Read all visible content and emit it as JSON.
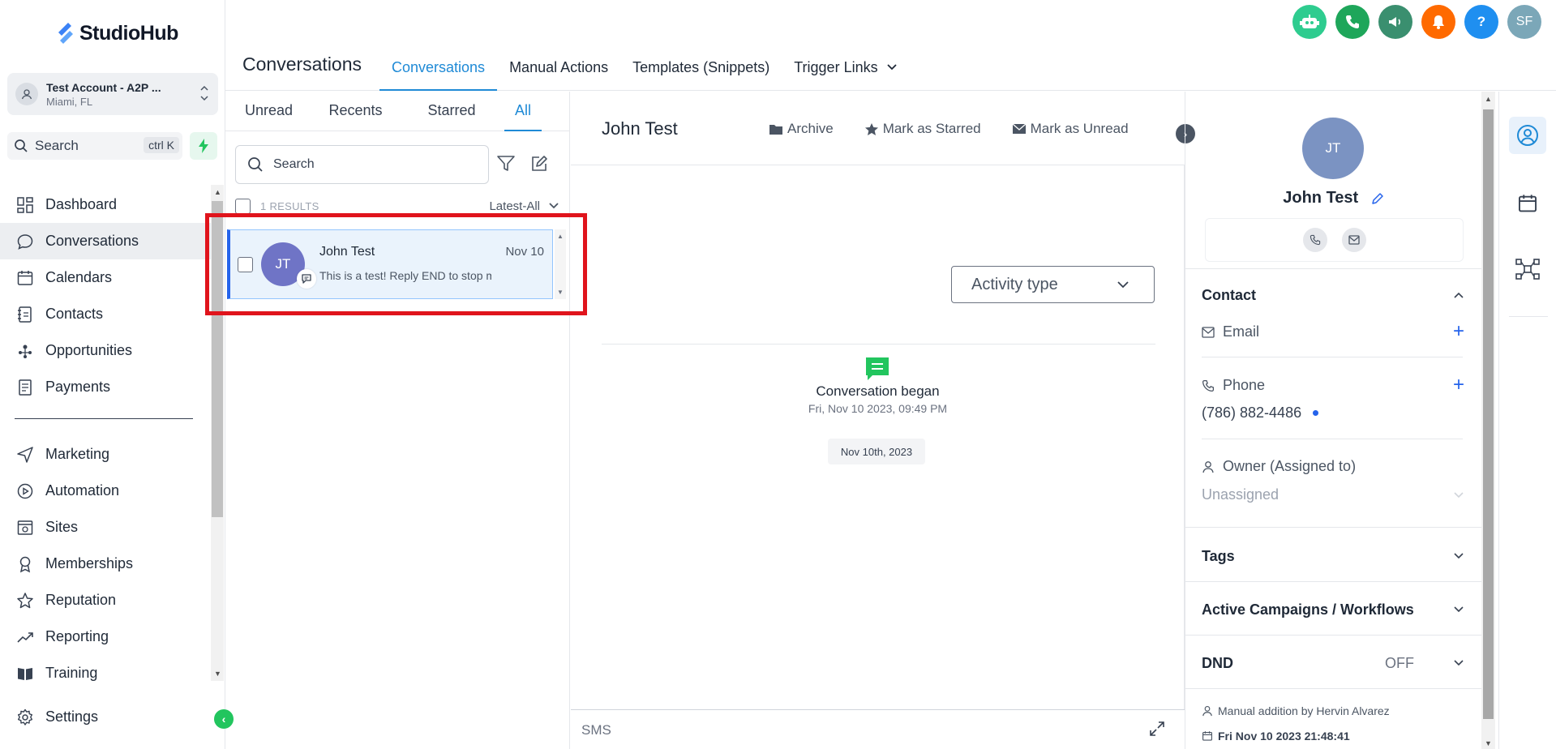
{
  "brand": {
    "name": "StudioHub"
  },
  "account": {
    "name": "Test Account - A2P ...",
    "location": "Miami, FL"
  },
  "sidebar_search": {
    "label": "Search",
    "shortcut": "ctrl K"
  },
  "nav": {
    "primary": [
      {
        "label": "Dashboard",
        "icon": "dashboard-icon"
      },
      {
        "label": "Conversations",
        "icon": "chat-bubble-icon"
      },
      {
        "label": "Calendars",
        "icon": "calendar-icon"
      },
      {
        "label": "Contacts",
        "icon": "contacts-icon"
      },
      {
        "label": "Opportunities",
        "icon": "opportunities-icon"
      },
      {
        "label": "Payments",
        "icon": "payments-icon"
      }
    ],
    "secondary": [
      {
        "label": "Marketing",
        "icon": "send-icon"
      },
      {
        "label": "Automation",
        "icon": "automation-icon"
      },
      {
        "label": "Sites",
        "icon": "sites-icon"
      },
      {
        "label": "Memberships",
        "icon": "badge-icon"
      },
      {
        "label": "Reputation",
        "icon": "star-icon"
      },
      {
        "label": "Reporting",
        "icon": "trend-icon"
      },
      {
        "label": "Training",
        "icon": "book-icon"
      }
    ],
    "settings_label": "Settings"
  },
  "header": {
    "title": "Conversations",
    "tabs": [
      "Conversations",
      "Manual Actions",
      "Templates (Snippets)",
      "Trigger Links"
    ],
    "avatar_initials": "SF",
    "help_label": "?"
  },
  "colors": {
    "accent": "#1f8ad6",
    "bot": "#2ecc8f",
    "phone": "#1ea65a",
    "megaphone": "#3a8f6f",
    "bell": "#ff6a00",
    "help": "#1f8ff0",
    "user": "#7ba7b8"
  },
  "list": {
    "tabs": [
      "Unread",
      "Recents",
      "Starred",
      "All"
    ],
    "search_placeholder": "Search",
    "results_label": "1 RESULTS",
    "sort_label": "Latest-All",
    "items": [
      {
        "initials": "JT",
        "name": "John Test",
        "date": "Nov 10",
        "snippet": "This is a test! Reply END to stop m"
      }
    ]
  },
  "chat": {
    "contact_name": "John Test",
    "actions": [
      "Archive",
      "Mark as Starred",
      "Mark as Unread"
    ],
    "activity_type_placeholder": "Activity type",
    "began_title": "Conversation began",
    "began_time": "Fri, Nov 10 2023, 09:49 PM",
    "date_pill": "Nov 10th, 2023",
    "composer_channel": "SMS"
  },
  "contact": {
    "initials": "JT",
    "name": "John Test",
    "section_contact": "Contact",
    "email_label": "Email",
    "phone_label": "Phone",
    "phone_value": "(786) 882-4486",
    "owner_label": "Owner (Assigned to)",
    "owner_value": "Unassigned",
    "tags_label": "Tags",
    "campaigns_label": "Active Campaigns / Workflows",
    "dnd_label": "DND",
    "dnd_value": "OFF",
    "meta_added_by": "Manual addition by Hervin Alvarez",
    "meta_date": "Fri Nov 10 2023 21:48:41"
  }
}
